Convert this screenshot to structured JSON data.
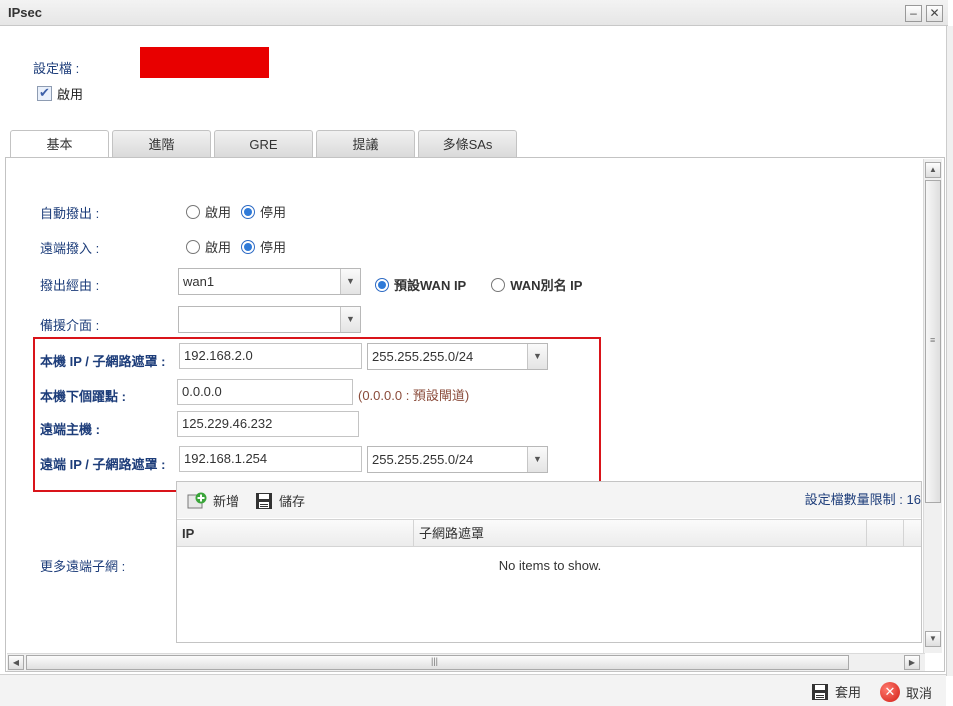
{
  "window": {
    "title": "IPsec",
    "minimize_symbol": "–",
    "close_symbol": "✕"
  },
  "profile": {
    "label": "設定檔 :",
    "enable_label": "啟用",
    "enable_checked": true
  },
  "tabs": [
    {
      "label": "基本",
      "active": true
    },
    {
      "label": "進階",
      "active": false
    },
    {
      "label": "GRE",
      "active": false
    },
    {
      "label": "提議",
      "active": false
    },
    {
      "label": "多條SAs",
      "active": false
    }
  ],
  "form": {
    "auto_dialout": {
      "label": "自動撥出 :",
      "opt_enable": "啟用",
      "opt_disable": "停用",
      "selected": "停用"
    },
    "remote_dialin": {
      "label": "遠端撥入 :",
      "opt_enable": "啟用",
      "opt_disable": "停用",
      "selected": "停用"
    },
    "dialout_via": {
      "label": "撥出經由 :",
      "value": "wan1",
      "opt_default_wan": "預設WAN IP",
      "opt_wan_alias": "WAN別名 IP",
      "selected": "預設WAN IP"
    },
    "backup_interface": {
      "label": "備援介面 :",
      "value": ""
    },
    "local_ip": {
      "label": "本機 IP / 子網路遮罩 :",
      "ip": "192.168.2.0",
      "mask": "255.255.255.0/24"
    },
    "local_next_hop": {
      "label": "本機下個躍點 :",
      "value": "0.0.0.0",
      "hint": "(0.0.0.0 : 預設閘道)"
    },
    "remote_host": {
      "label": "遠端主機 :",
      "value": "125.229.46.232"
    },
    "remote_ip": {
      "label": "遠端 IP / 子網路遮罩 :",
      "ip": "192.168.1.254",
      "mask": "255.255.255.0/24"
    },
    "more_remote_subnets": {
      "label": "更多遠端子網 :"
    }
  },
  "grid": {
    "add_label": "新增",
    "save_label": "儲存",
    "limit_label": "設定檔數量限制 :",
    "limit_value": "16",
    "columns": [
      "IP",
      "子網路遮罩"
    ],
    "empty_text": "No items to show."
  },
  "footer": {
    "apply_label": "套用",
    "cancel_label": "取消"
  },
  "colors": {
    "label_blue": "#1d3d7a",
    "highlight_red": "#d9141a",
    "redacted": "#e80000"
  }
}
